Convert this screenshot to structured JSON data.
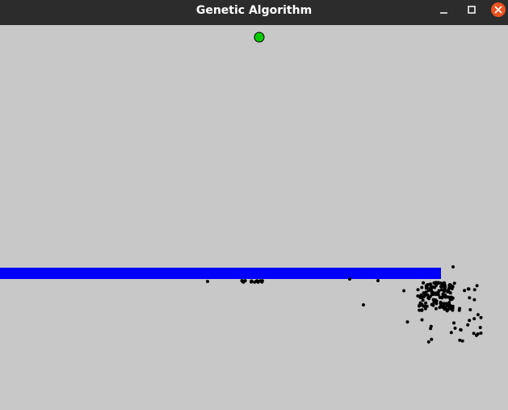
{
  "window": {
    "title": "Genetic Algorithm",
    "controls": [
      "minimize-icon",
      "maximize-icon",
      "close-icon"
    ]
  },
  "colors": {
    "titlebar": "#2c2c2c",
    "background": "#c8c8c8",
    "target": "#00cc00",
    "obstacle": "#0000ff",
    "agent": "#000000",
    "close_button": "#e95420"
  },
  "scene": {
    "target": "green-circle",
    "obstacle": "blue-bar",
    "agents": "black-dots"
  }
}
